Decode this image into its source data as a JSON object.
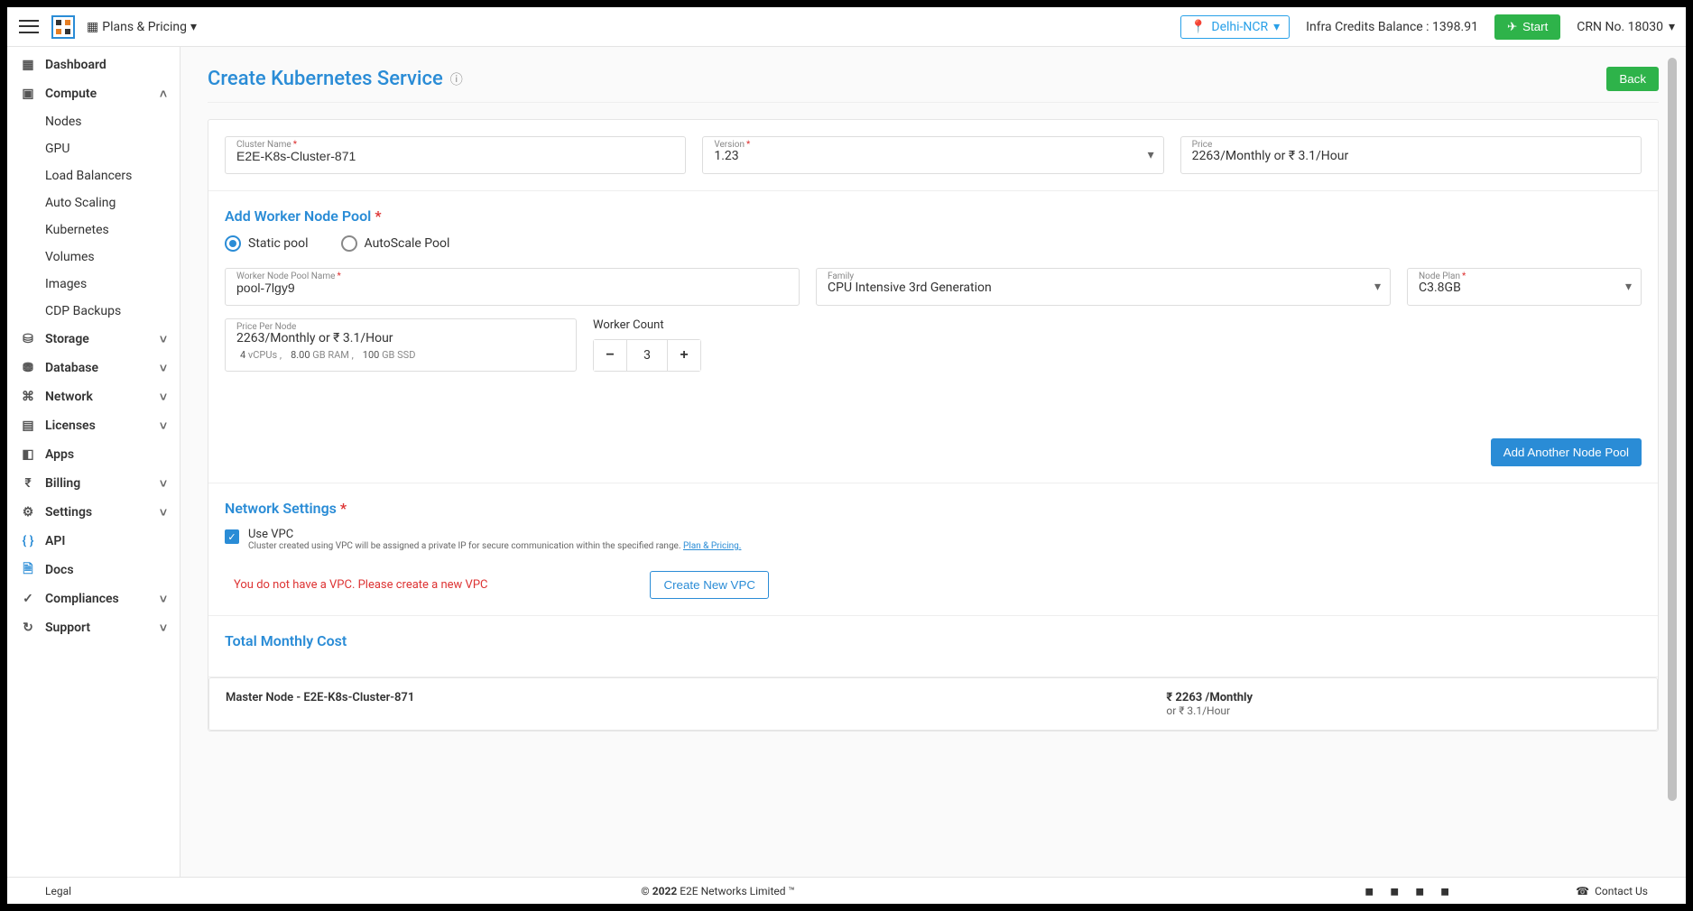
{
  "header": {
    "plans": "Plans & Pricing",
    "region": "Delhi-NCR",
    "credits_label": "Infra Credits Balance : 1398.91",
    "start_label": "Start",
    "crn": "CRN No. 18030"
  },
  "sidebar": {
    "dashboard": "Dashboard",
    "compute": "Compute",
    "compute_items": [
      "Nodes",
      "GPU",
      "Load Balancers",
      "Auto Scaling",
      "Kubernetes",
      "Volumes",
      "Images",
      "CDP Backups"
    ],
    "storage": "Storage",
    "database": "Database",
    "network": "Network",
    "licenses": "Licenses",
    "apps": "Apps",
    "billing": "Billing",
    "settings": "Settings",
    "api": "API",
    "docs": "Docs",
    "compliances": "Compliances",
    "support": "Support"
  },
  "page": {
    "title": "Create Kubernetes Service",
    "back": "Back"
  },
  "cluster": {
    "name_label": "Cluster Name",
    "name_value": "E2E-K8s-Cluster-871",
    "version_label": "Version",
    "version_value": "1.23",
    "price_label": "Price",
    "price_value": "2263/Monthly or ₹ 3.1/Hour"
  },
  "nodepool": {
    "title": "Add Worker Node Pool",
    "radio_static": "Static pool",
    "radio_autoscale": "AutoScale Pool",
    "name_label": "Worker Node Pool Name",
    "name_value": "pool-7lgy9",
    "family_label": "Family",
    "family_value": "CPU Intensive 3rd Generation",
    "plan_label": "Node Plan",
    "plan_value": "C3.8GB",
    "price_label": "Price Per Node",
    "price_value": "2263/Monthly or ₹ 3.1/Hour",
    "spec_vcpu_n": "4",
    "spec_vcpu": "vCPUs ,",
    "spec_ram_n": "8.00",
    "spec_ram": "GB RAM ,",
    "spec_ssd_n": "100",
    "spec_ssd": "GB SSD",
    "worker_count_label": "Worker Count",
    "worker_count": "3",
    "add_another": "Add Another Node Pool"
  },
  "net": {
    "title": "Network Settings",
    "use_vpc": "Use VPC",
    "help": "Cluster created using VPC will be assigned a private IP for secure communication within the specified range.",
    "plan_link": "Plan & Pricing.",
    "warning": "You do not have a VPC. Please create a new VPC",
    "create": "Create New VPC"
  },
  "cost": {
    "title": "Total Monthly Cost",
    "master_label": "Master Node - E2E-K8s-Cluster-871",
    "monthly": "₹ 2263 /Monthly",
    "hourly": "or ₹ 3.1/Hour"
  },
  "footer": {
    "legal": "Legal",
    "copyright_pre": "© 2022",
    "copyright": " E2E Networks Limited ™",
    "contact": "Contact Us"
  }
}
